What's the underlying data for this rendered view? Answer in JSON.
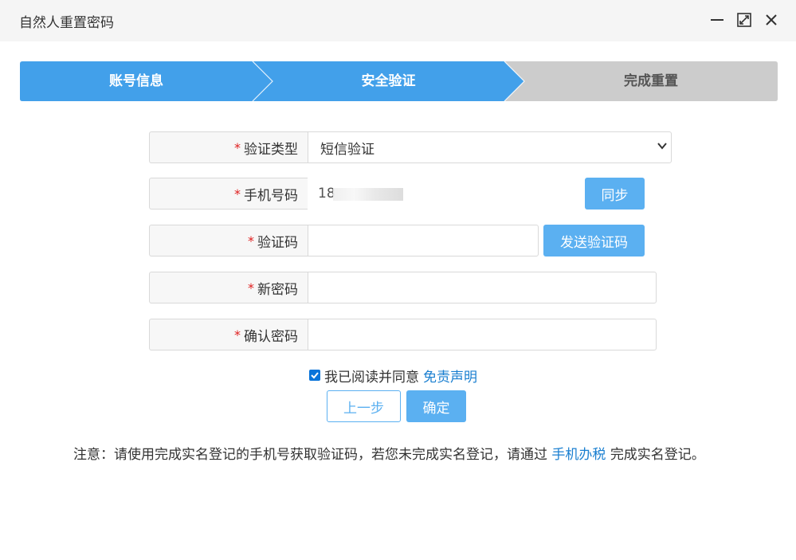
{
  "window": {
    "title": "自然人重置密码",
    "controls": [
      "minimize-icon",
      "maximize-icon",
      "close-icon"
    ]
  },
  "steps": [
    {
      "label": "账号信息",
      "state": "done"
    },
    {
      "label": "安全验证",
      "state": "active"
    },
    {
      "label": "完成重置",
      "state": "pending"
    }
  ],
  "colors": {
    "step_active": "#42a0ea",
    "step_pending": "#cccccc",
    "button_blue": "#5bb0f1",
    "link": "#1a7fd0",
    "required": "#e02020"
  },
  "form": {
    "required_mark": "*",
    "verify_type": {
      "label": "验证类型",
      "value": "短信验证"
    },
    "phone": {
      "label": "手机号码",
      "value": "18",
      "sync_button": "同步"
    },
    "code": {
      "label": "验证码",
      "value": "",
      "send_button": "发送验证码"
    },
    "new_password": {
      "label": "新密码",
      "value": ""
    },
    "confirm_password": {
      "label": "确认密码",
      "value": ""
    }
  },
  "agreement": {
    "checked": true,
    "text": "我已阅读并同意",
    "link": "免责声明"
  },
  "buttons": {
    "prev": "上一步",
    "confirm": "确定"
  },
  "notice": {
    "prefix": "注意：请使用完成实名登记的手机号获取验证码，若您未完成实名登记，请通过",
    "link": "手机办税",
    "suffix": "完成实名登记。"
  }
}
